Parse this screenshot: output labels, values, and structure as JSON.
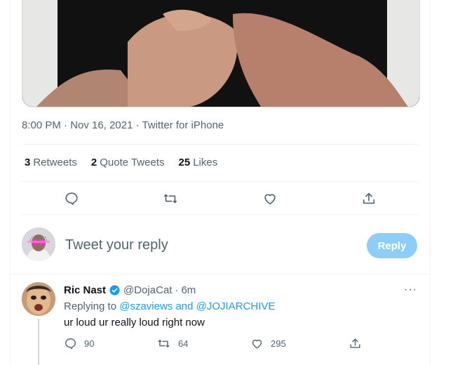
{
  "tweet": {
    "time": "8:00 PM",
    "date": "Nov 16, 2021",
    "source": "Twitter for iPhone",
    "dot": "·"
  },
  "stats": {
    "retweets_count": "3",
    "retweets_label": "Retweets",
    "quote_count": "2",
    "quote_label": "Quote Tweets",
    "likes_count": "25",
    "likes_label": "Likes"
  },
  "actions": {
    "icons": [
      "reply-icon",
      "retweet-icon",
      "like-icon",
      "share-icon"
    ]
  },
  "composer": {
    "placeholder": "Tweet your reply",
    "reply_button": "Reply"
  },
  "reply": {
    "name": "Ric Nast",
    "handle": "@DojaCat",
    "time": "6m",
    "replying_prefix": "Replying to",
    "replying_to": "@szaviews and @JOJIARCHIVE",
    "text": "ur loud ur really loud right now",
    "reply_count": "90",
    "retweet_count": "64",
    "like_count": "295",
    "more": "···"
  },
  "colors": {
    "accent": "#1d9bf0",
    "secondary_text": "#536471",
    "reply_button_disabled": "#8ecdf8",
    "verified": "#1d9bf0"
  }
}
